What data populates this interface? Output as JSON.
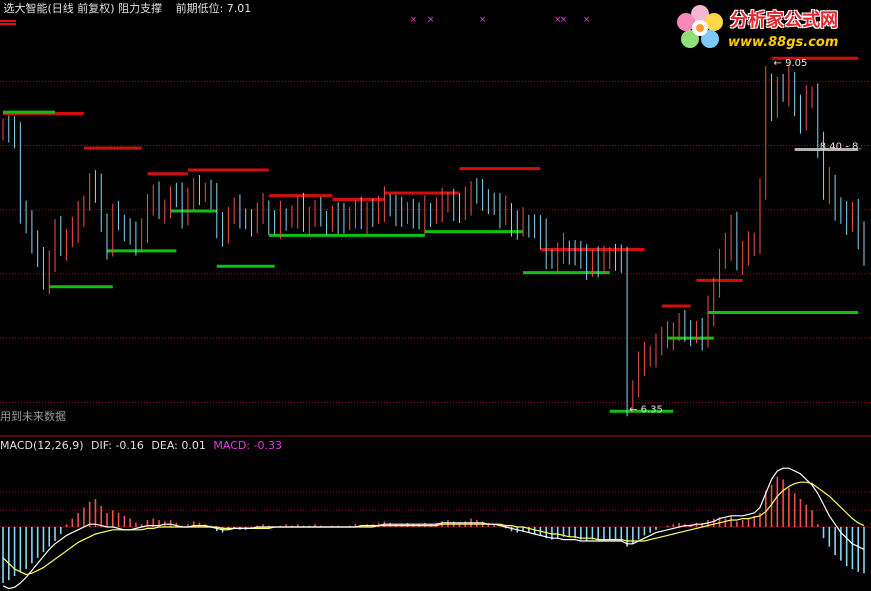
{
  "header": {
    "title": "选大智能(日线 前复权) 阻力支撑",
    "prev_low_label": "前期低位:",
    "prev_low_value": "7.01"
  },
  "footer_note": "用到未来数据",
  "macd_header": {
    "name": "MACD(12,26,9)",
    "dif_label": "DIF:",
    "dif_value": "-0.16",
    "dea_label": "DEA:",
    "dea_value": "0.01",
    "macd_label": "MACD:",
    "macd_value": "-0.33"
  },
  "logo": {
    "title": "分析家公式网",
    "url": "www.88gs.com"
  },
  "colors": {
    "up": "#f05050",
    "down": "#8ad6f0",
    "resistance": "#d01010",
    "support": "#10c010",
    "dif_line": "#ffffff",
    "dea_line": "#ffff60",
    "macd_label": "#e040e0",
    "grid": "#8a1010",
    "gray_level": "#b0b0b0"
  },
  "chart_data": [
    {
      "type": "bar",
      "title": "选大智能(日线 前复权) 阻力支撑",
      "ylim": [
        6.2,
        9.3
      ],
      "grid": true,
      "price_labels": [
        {
          "text": "9.05",
          "index": 133,
          "value": 9.05,
          "marker": "←"
        },
        {
          "text": "6.35",
          "index": 108,
          "value": 6.35,
          "marker": "←"
        },
        {
          "text": "8.40 - 8.",
          "index": 141,
          "value": 8.4,
          "marker": ""
        }
      ],
      "close": [
        8.55,
        8.52,
        8.45,
        7.9,
        7.8,
        7.62,
        7.55,
        7.35,
        7.5,
        7.72,
        7.6,
        7.68,
        7.75,
        7.85,
        7.95,
        8.1,
        8.05,
        7.8,
        7.62,
        7.85,
        7.8,
        7.75,
        7.7,
        7.65,
        7.7,
        7.95,
        8.0,
        7.9,
        7.92,
        8.0,
        7.98,
        7.85,
        8.0,
        8.05,
        8.02,
        8.05,
        8.0,
        7.75,
        7.72,
        7.85,
        7.9,
        7.85,
        7.82,
        7.8,
        7.85,
        7.9,
        7.8,
        7.78,
        7.85,
        7.82,
        7.85,
        7.9,
        7.8,
        7.85,
        7.88,
        7.83,
        7.8,
        7.85,
        7.82,
        7.8,
        7.85,
        7.88,
        7.82,
        7.9,
        7.85,
        7.9,
        7.95,
        7.92,
        7.88,
        7.85,
        7.9,
        7.85,
        7.82,
        7.88,
        7.85,
        7.9,
        7.95,
        7.98,
        7.92,
        7.88,
        7.95,
        8.05,
        8.02,
        8.0,
        7.95,
        7.92,
        7.85,
        7.88,
        7.8,
        7.75,
        7.8,
        7.78,
        7.75,
        7.7,
        7.52,
        7.5,
        7.55,
        7.6,
        7.58,
        7.55,
        7.5,
        7.45,
        7.52,
        7.48,
        7.5,
        7.55,
        7.52,
        7.48,
        6.4,
        6.5,
        6.7,
        6.75,
        6.78,
        6.85,
        6.88,
        6.9,
        6.95,
        7.0,
        6.98,
        6.92,
        6.95,
        6.9,
        7.1,
        7.3,
        7.5,
        7.6,
        7.8,
        7.5,
        7.55,
        7.6,
        7.65,
        8.05,
        8.9,
        8.7,
        8.85,
        8.8,
        8.9,
        8.7,
        8.6,
        8.75,
        8.8,
        8.4,
        8.05,
        8.1,
        7.9,
        7.85,
        7.8,
        7.9,
        7.7,
        7.55
      ],
      "macd": [
        -0.4,
        -0.38,
        -0.35,
        -0.32,
        -0.3,
        -0.26,
        -0.22,
        -0.18,
        -0.14,
        -0.1,
        -0.05,
        0.02,
        0.06,
        0.1,
        0.14,
        0.18,
        0.2,
        0.15,
        0.1,
        0.12,
        0.1,
        0.08,
        0.06,
        0.03,
        0.02,
        0.05,
        0.06,
        0.05,
        0.04,
        0.05,
        0.03,
        0.01,
        0.02,
        0.04,
        0.03,
        0.02,
        0.01,
        -0.03,
        -0.04,
        -0.02,
        -0.01,
        -0.02,
        -0.02,
        -0.01,
        0.01,
        0.02,
        0.01,
        0.0,
        0.01,
        0.02,
        0.01,
        0.02,
        0.01,
        0.01,
        0.02,
        0.01,
        0.0,
        0.01,
        0.01,
        0.0,
        0.01,
        0.02,
        0.01,
        0.02,
        0.02,
        0.03,
        0.04,
        0.03,
        0.02,
        0.02,
        0.03,
        0.02,
        0.02,
        0.03,
        0.02,
        0.03,
        0.04,
        0.05,
        0.04,
        0.03,
        0.04,
        0.06,
        0.05,
        0.04,
        0.03,
        0.02,
        0.0,
        -0.01,
        -0.03,
        -0.04,
        -0.03,
        -0.04,
        -0.05,
        -0.06,
        -0.08,
        -0.09,
        -0.08,
        -0.07,
        -0.07,
        -0.08,
        -0.09,
        -0.1,
        -0.09,
        -0.1,
        -0.1,
        -0.09,
        -0.09,
        -0.1,
        -0.14,
        -0.12,
        -0.09,
        -0.06,
        -0.04,
        -0.02,
        0.0,
        0.01,
        0.02,
        0.03,
        0.02,
        0.02,
        0.03,
        0.03,
        0.05,
        0.06,
        0.07,
        0.06,
        0.08,
        0.04,
        0.05,
        0.06,
        0.08,
        0.1,
        0.26,
        0.3,
        0.36,
        0.34,
        0.28,
        0.24,
        0.2,
        0.16,
        0.12,
        0.02,
        -0.08,
        -0.14,
        -0.2,
        -0.24,
        -0.28,
        -0.3,
        -0.32,
        -0.33
      ],
      "dif": [
        -0.42,
        -0.44,
        -0.43,
        -0.4,
        -0.36,
        -0.31,
        -0.26,
        -0.21,
        -0.16,
        -0.12,
        -0.09,
        -0.06,
        -0.04,
        -0.02,
        0.0,
        0.02,
        0.02,
        0.01,
        0.0,
        0.0,
        -0.01,
        -0.02,
        -0.02,
        -0.01,
        0.0,
        0.01,
        0.01,
        0.01,
        0.02,
        0.02,
        0.01,
        0.0,
        0.0,
        0.01,
        0.01,
        0.01,
        0.0,
        -0.01,
        -0.02,
        -0.02,
        -0.01,
        -0.01,
        -0.01,
        -0.01,
        0.0,
        0.0,
        0.0,
        0.0,
        0.0,
        0.0,
        0.0,
        0.0,
        0.0,
        0.0,
        0.0,
        0.0,
        0.0,
        0.0,
        0.0,
        0.0,
        0.0,
        0.0,
        0.01,
        0.01,
        0.01,
        0.01,
        0.02,
        0.02,
        0.02,
        0.02,
        0.02,
        0.02,
        0.02,
        0.02,
        0.02,
        0.02,
        0.03,
        0.03,
        0.03,
        0.03,
        0.03,
        0.03,
        0.03,
        0.03,
        0.02,
        0.02,
        0.01,
        0.0,
        -0.01,
        -0.02,
        -0.03,
        -0.04,
        -0.05,
        -0.06,
        -0.07,
        -0.08,
        -0.08,
        -0.09,
        -0.09,
        -0.09,
        -0.1,
        -0.1,
        -0.1,
        -0.1,
        -0.1,
        -0.1,
        -0.1,
        -0.1,
        -0.12,
        -0.12,
        -0.1,
        -0.08,
        -0.06,
        -0.04,
        -0.03,
        -0.02,
        -0.01,
        0.0,
        0.01,
        0.01,
        0.02,
        0.02,
        0.03,
        0.04,
        0.06,
        0.07,
        0.08,
        0.08,
        0.08,
        0.09,
        0.1,
        0.14,
        0.24,
        0.34,
        0.4,
        0.42,
        0.42,
        0.4,
        0.38,
        0.34,
        0.3,
        0.24,
        0.16,
        0.08,
        0.02,
        -0.04,
        -0.08,
        -0.12,
        -0.14,
        -0.16
      ],
      "dea": [
        -0.22,
        -0.26,
        -0.3,
        -0.32,
        -0.34,
        -0.33,
        -0.31,
        -0.29,
        -0.26,
        -0.23,
        -0.2,
        -0.17,
        -0.14,
        -0.11,
        -0.09,
        -0.07,
        -0.05,
        -0.04,
        -0.03,
        -0.02,
        -0.02,
        -0.02,
        -0.02,
        -0.02,
        -0.02,
        -0.01,
        -0.01,
        0.0,
        0.0,
        0.0,
        0.0,
        0.0,
        0.0,
        0.0,
        0.0,
        0.0,
        0.0,
        0.0,
        -0.01,
        -0.01,
        -0.01,
        -0.01,
        -0.01,
        -0.01,
        -0.01,
        -0.01,
        -0.01,
        0.0,
        0.0,
        0.0,
        0.0,
        0.0,
        0.0,
        0.0,
        0.0,
        0.0,
        0.0,
        0.0,
        0.0,
        0.0,
        0.0,
        0.0,
        0.0,
        0.0,
        0.0,
        0.01,
        0.01,
        0.01,
        0.01,
        0.01,
        0.01,
        0.01,
        0.01,
        0.01,
        0.01,
        0.01,
        0.02,
        0.02,
        0.02,
        0.02,
        0.02,
        0.02,
        0.02,
        0.02,
        0.02,
        0.02,
        0.02,
        0.01,
        0.01,
        0.0,
        0.0,
        -0.01,
        -0.02,
        -0.03,
        -0.04,
        -0.05,
        -0.05,
        -0.06,
        -0.07,
        -0.07,
        -0.08,
        -0.08,
        -0.08,
        -0.09,
        -0.09,
        -0.09,
        -0.09,
        -0.09,
        -0.1,
        -0.1,
        -0.1,
        -0.1,
        -0.09,
        -0.08,
        -0.07,
        -0.06,
        -0.05,
        -0.04,
        -0.03,
        -0.02,
        -0.01,
        0.0,
        0.01,
        0.02,
        0.03,
        0.04,
        0.05,
        0.05,
        0.06,
        0.06,
        0.07,
        0.08,
        0.11,
        0.16,
        0.22,
        0.26,
        0.29,
        0.31,
        0.32,
        0.32,
        0.31,
        0.28,
        0.25,
        0.22,
        0.18,
        0.14,
        0.1,
        0.06,
        0.03,
        0.01
      ],
      "resistance": [
        {
          "start": 0,
          "end": 14,
          "value": 8.65
        },
        {
          "start": 14,
          "end": 24,
          "value": 8.38
        },
        {
          "start": 25,
          "end": 32,
          "value": 8.18
        },
        {
          "start": 32,
          "end": 46,
          "value": 8.21
        },
        {
          "start": 46,
          "end": 57,
          "value": 8.01
        },
        {
          "start": 57,
          "end": 66,
          "value": 7.98
        },
        {
          "start": 66,
          "end": 79,
          "value": 8.03
        },
        {
          "start": 79,
          "end": 93,
          "value": 8.22
        },
        {
          "start": 93,
          "end": 111,
          "value": 7.59
        },
        {
          "start": 114,
          "end": 119,
          "value": 7.15
        },
        {
          "start": 120,
          "end": 128,
          "value": 7.35
        },
        {
          "start": 133,
          "end": 148,
          "value": 9.08
        }
      ],
      "support": [
        {
          "start": 0,
          "end": 9,
          "value": 8.66
        },
        {
          "start": 8,
          "end": 19,
          "value": 7.3
        },
        {
          "start": 18,
          "end": 30,
          "value": 7.58
        },
        {
          "start": 29,
          "end": 37,
          "value": 7.89
        },
        {
          "start": 37,
          "end": 47,
          "value": 7.46
        },
        {
          "start": 46,
          "end": 73,
          "value": 7.7
        },
        {
          "start": 73,
          "end": 90,
          "value": 7.73
        },
        {
          "start": 90,
          "end": 105,
          "value": 7.41
        },
        {
          "start": 105,
          "end": 116,
          "value": 6.33
        },
        {
          "start": 115,
          "end": 123,
          "value": 6.9
        },
        {
          "start": 122,
          "end": 148,
          "value": 7.1
        }
      ],
      "level_8_40": {
        "start": 137,
        "end": 148,
        "value": 8.4
      },
      "top_markers": [
        71,
        74,
        83,
        96,
        97,
        101
      ]
    }
  ]
}
